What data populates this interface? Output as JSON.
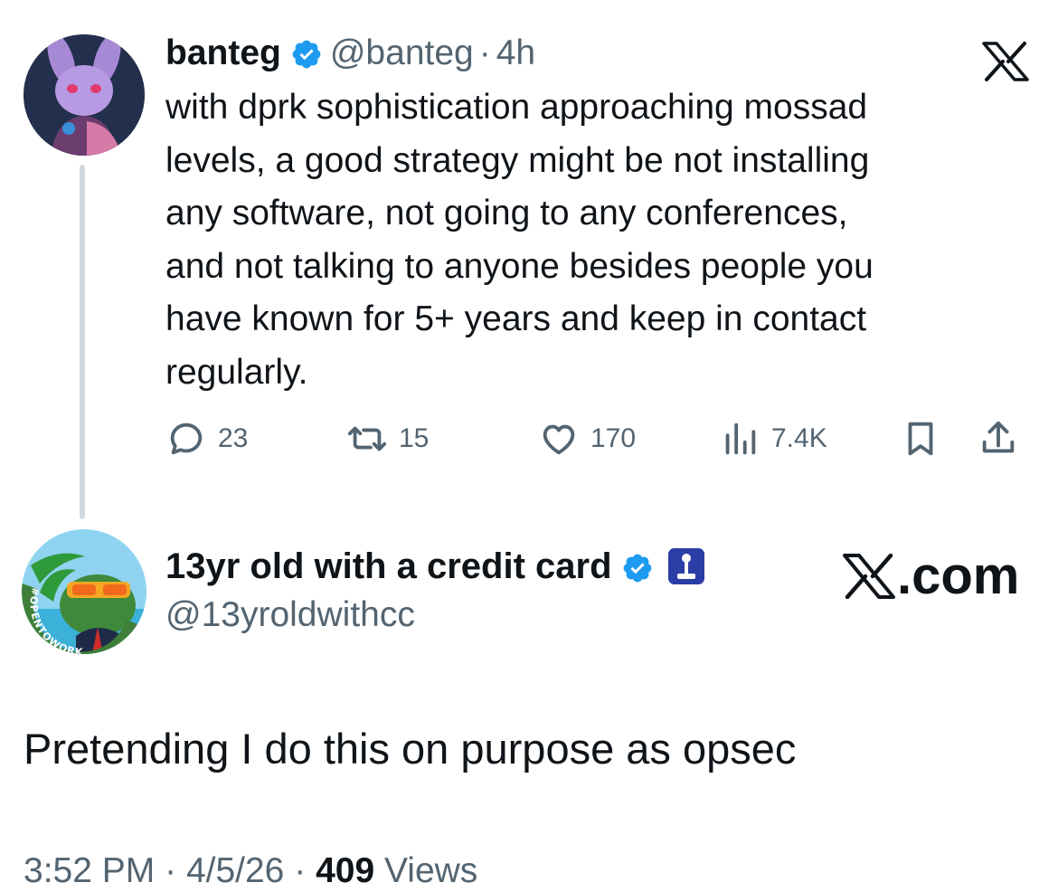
{
  "quoted_tweet": {
    "author_name": "banteg",
    "handle": "@banteg",
    "separator": "·",
    "time": "4h",
    "text": "with dprk sophistication approaching mossad\nlevels, a good strategy might be not installing\nany software, not going to any conferences,\nand not talking to anyone besides people you\nhave known for 5+ years and keep in contact\nregularly.",
    "replies": "23",
    "reposts": "15",
    "likes": "170",
    "views": "7.4K",
    "icons": [
      "verified-badge-icon",
      "x-logo-icon",
      "reply-icon",
      "repost-icon",
      "like-icon",
      "views-icon",
      "bookmark-icon",
      "share-icon"
    ]
  },
  "reply_tweet": {
    "author_name": "13yr old with a credit card",
    "handle": "@13yroldwithcc",
    "watermark_suffix": ".com",
    "avatar_ring_text": "#OPENTOWORK",
    "text": "Pretending I do this on purpose as opsec",
    "time": "3:52 PM",
    "separator": "·",
    "date": "4/5/26",
    "views_count": "409",
    "views_label": "Views"
  },
  "colors": {
    "text_primary": "#0f1419",
    "text_secondary": "#536471",
    "verified_blue": "#1d9bf0",
    "thread_line": "#cfd9de",
    "opentowork_green": "#3f7f3a"
  }
}
